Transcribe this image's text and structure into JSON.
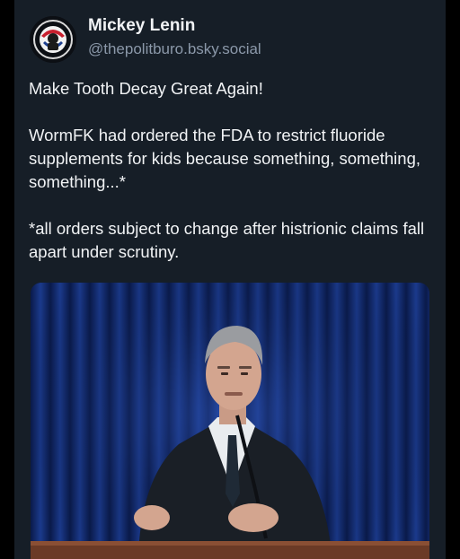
{
  "post": {
    "author": {
      "display_name": "Mickey Lenin",
      "handle": "@thepolitburo.bsky.social"
    },
    "paragraphs": [
      "Make Tooth Decay Great Again!",
      "WormFK had ordered the FDA to restrict fluoride supplements for kids because something, something, something...*",
      "*all orders subject to change after histrionic claims fall apart under scrutiny."
    ],
    "media": {
      "kind": "video-still"
    }
  }
}
